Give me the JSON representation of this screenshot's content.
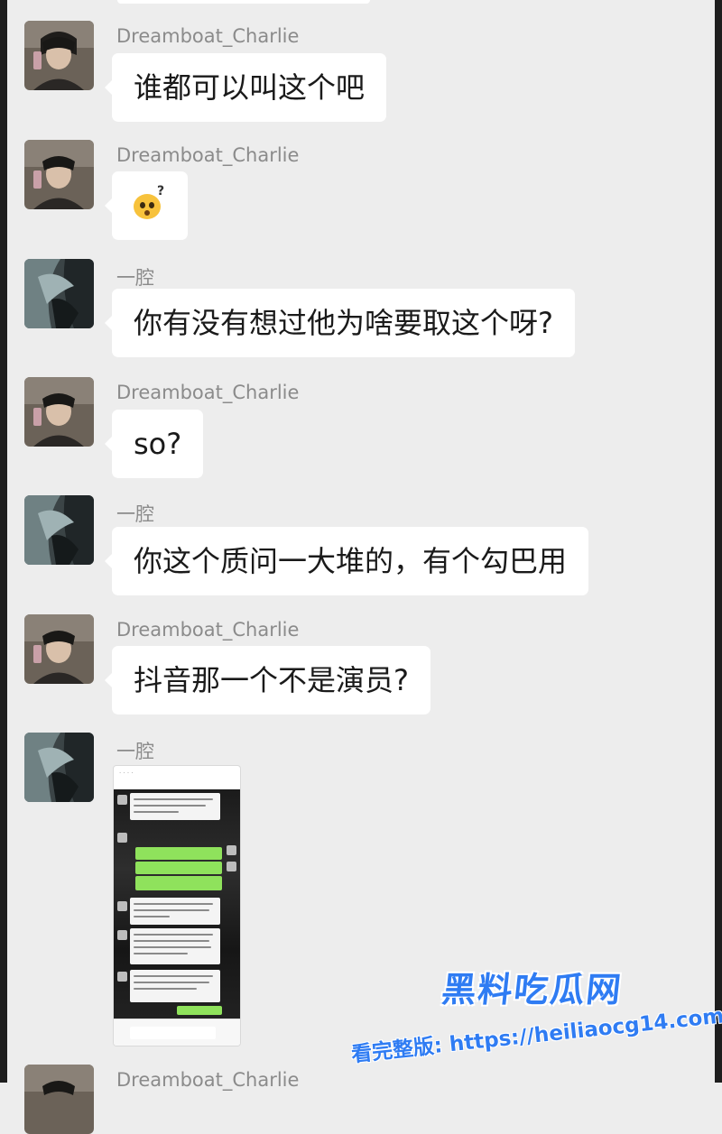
{
  "messages": [
    {
      "sender": "Dreamboat_Charlie",
      "avatar": "avatar-dreamboat-charlie",
      "type": "text",
      "text": "谁都可以叫这个吧"
    },
    {
      "sender": "Dreamboat_Charlie",
      "avatar": "avatar-dreamboat-charlie",
      "type": "emoji",
      "emoji": "confused-face-with-question-mark"
    },
    {
      "sender": "一腔",
      "avatar": "avatar-yiqiang",
      "type": "text",
      "text": "你有没有想过他为啥要取这个呀?"
    },
    {
      "sender": "Dreamboat_Charlie",
      "avatar": "avatar-dreamboat-charlie",
      "type": "text",
      "text": "so?"
    },
    {
      "sender": "一腔",
      "avatar": "avatar-yiqiang",
      "type": "text",
      "text": "你这个质问一大堆的，有个勾巴用"
    },
    {
      "sender": "Dreamboat_Charlie",
      "avatar": "avatar-dreamboat-charlie",
      "type": "text",
      "text": "抖音那一个不是演员?"
    },
    {
      "sender": "一腔",
      "avatar": "avatar-yiqiang",
      "type": "image",
      "image": "chat-screenshot-thumbnail"
    },
    {
      "sender": "Dreamboat_Charlie",
      "avatar": "avatar-dreamboat-charlie",
      "type": "partial"
    }
  ],
  "watermark": {
    "brand": "黑料吃瓜网",
    "url_text": "看完整版: https://heiliaocg14.com"
  },
  "colors": {
    "background": "#ededed",
    "bubble": "#ffffff",
    "name_text": "#8b8b8b",
    "message_text": "#1a1a1a",
    "watermark_blue": "#2f7cf3",
    "green_bubble": "#8fe25c"
  }
}
